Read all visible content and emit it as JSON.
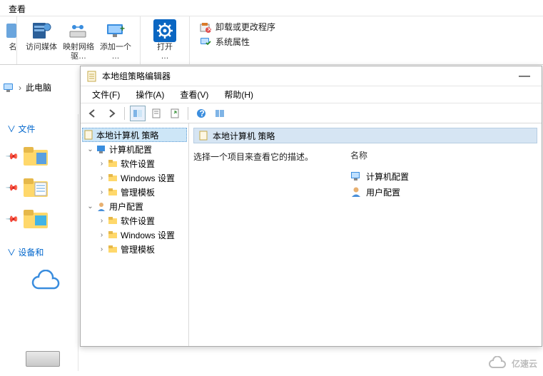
{
  "top_tab": "查看",
  "ribbon": {
    "g1": {
      "media": "访问媒体",
      "mapnet": "映射网络\n驱…",
      "addone": "添加一个\n…"
    },
    "g2": {
      "open": "打开\n…"
    },
    "g3": {
      "uninstall": "卸载或更改程序",
      "sysprops": "系统属性"
    }
  },
  "crumb": {
    "thispc": "此电脑"
  },
  "sidebar": {
    "files_head": "文件",
    "devices_head": "设备和"
  },
  "mmc": {
    "title": "本地组策略编辑器",
    "menu": {
      "file": "文件(F)",
      "action": "操作(A)",
      "view": "查看(V)",
      "help": "帮助(H)"
    },
    "tree": {
      "root": "本地计算机 策略",
      "comp": "计算机配置",
      "soft": "软件设置",
      "win": "Windows 设置",
      "admin": "管理模板",
      "user": "用户配置"
    },
    "right": {
      "head": "本地计算机 策略",
      "desc": "选择一个项目来查看它的描述。",
      "col_name": "名称",
      "items": {
        "comp": "计算机配置",
        "user": "用户配置"
      }
    }
  },
  "watermark": "亿速云"
}
